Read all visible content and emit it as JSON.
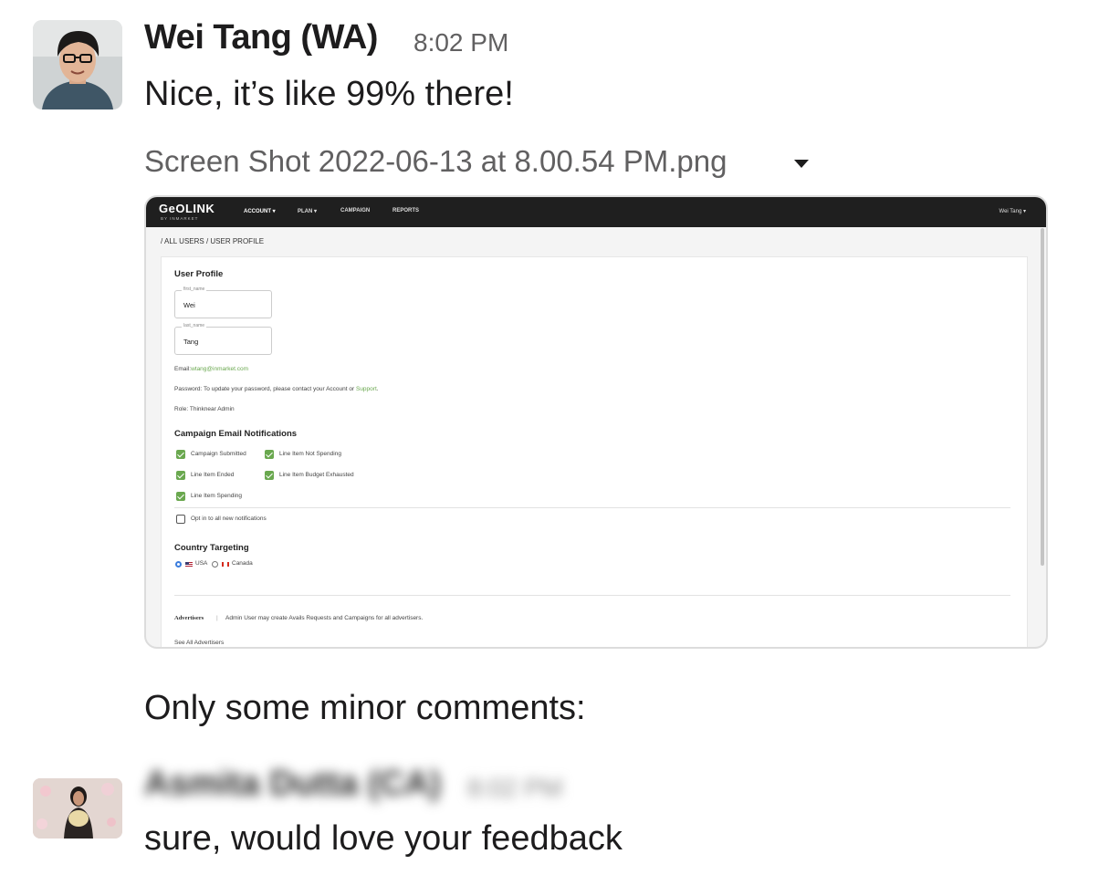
{
  "message1": {
    "author": "Wei Tang (WA)",
    "time": "8:02 PM",
    "text": "Nice, it’s like 99% there!",
    "attachment": {
      "filename": "Screen Shot 2022-06-13 at 8.00.54 PM.png",
      "screenshot": {
        "logo": "GeOLINK",
        "logo_sub": "BY INMARKET",
        "nav": [
          "ACCOUNT ▾",
          "PLAN ▾",
          "CAMPAIGN",
          "REPORTS"
        ],
        "user": "Wei Tang ▾",
        "breadcrumb": "/ ALL USERS / USER PROFILE",
        "profile_heading": "User Profile",
        "first_name_label": "first_name",
        "first_name_value": "Wei",
        "last_name_label": "last_name",
        "last_name_value": "Tang",
        "email_label": "Email:",
        "email_value": "wtang@inmarket.com",
        "password_text": "Password: To update your password, please contact your Account or",
        "password_link": "Support",
        "password_end": ".",
        "role": "Role: Thinknear Admin",
        "notifications_heading": "Campaign Email Notifications",
        "checkboxes": [
          {
            "label": "Campaign Submitted",
            "checked": true
          },
          {
            "label": "Line Item Not Spending",
            "checked": true
          },
          {
            "label": "Line Item Ended",
            "checked": true
          },
          {
            "label": "Line Item Budget Exhausted",
            "checked": true
          },
          {
            "label": "Line Item Spending",
            "checked": true
          }
        ],
        "opt_in_label": "Opt in to all new notifications",
        "country_heading": "Country Targeting",
        "country_usa": "USA",
        "country_canada": "Canada",
        "selected_country": "USA",
        "advertisers_label": "Advertisers",
        "advertisers_sep": "|",
        "advertisers_text": "Admin User may create Avails Requests and Campaigns for all advertisers.",
        "see_all": "See All Advertisers"
      }
    }
  },
  "message2": {
    "text": "Only some minor comments:"
  },
  "message3": {
    "author": "Asmita Dutta (CA)",
    "time": "8:02 PM",
    "text": "sure, would love your feedback"
  },
  "colors": {
    "text": "#1d1c1d",
    "muted": "#616061",
    "app_nav": "#1f1f1f",
    "app_green": "#6aa84f"
  }
}
